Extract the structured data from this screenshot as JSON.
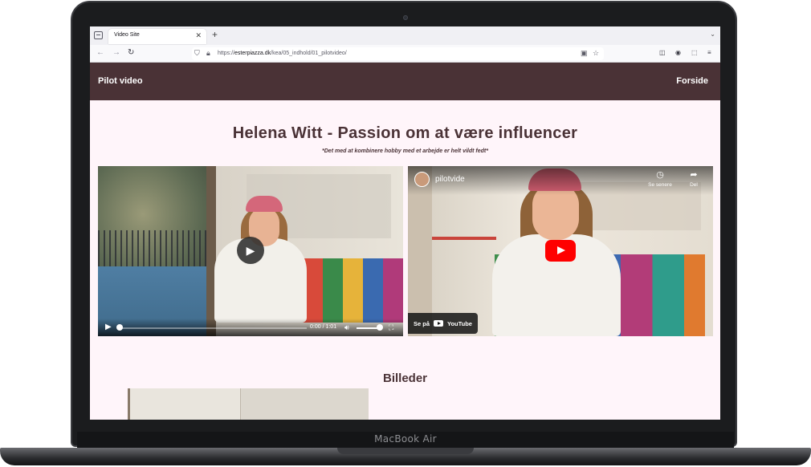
{
  "device": {
    "model_label": "MacBook Air"
  },
  "browser": {
    "tab_title": "Video Site",
    "tab_close": "✕",
    "new_tab": "+",
    "url_domain": "esterpiazza.dk",
    "url_prefix": "https://",
    "url_path": "/kea/05_indhold/01_pilotvideo/",
    "icons": [
      "tab-list-icon",
      "back-icon",
      "forward-icon",
      "reload-icon",
      "shield-icon",
      "lock-icon",
      "reader-view-icon",
      "bookmark-star-icon",
      "pocket-icon",
      "account-icon",
      "extensions-icon",
      "menu-icon",
      "tab-chevron-icon"
    ]
  },
  "site": {
    "brand": "Pilot video",
    "nav_link": "Forside",
    "title": "Helena Witt - Passion om at være influencer",
    "quote": "*Det med at kombinere hobby med et arbejde er helt vildt fedt*",
    "gallery_title": "Billeder"
  },
  "video_player": {
    "current_time": "0:00",
    "duration": "1:01",
    "time_display": "0:00 / 1:01",
    "progress": 0.0,
    "volume": 0.9
  },
  "youtube_embed": {
    "video_title": "pilotvide",
    "watch_later": "Se senere",
    "share": "Del",
    "watch_on": "Se på",
    "youtube_label": "YouTube"
  },
  "colors": {
    "header_bg": "#4a3236",
    "page_bg": "#fff5fa",
    "text_primary": "#4a3236",
    "youtube_red": "#ff0000"
  }
}
